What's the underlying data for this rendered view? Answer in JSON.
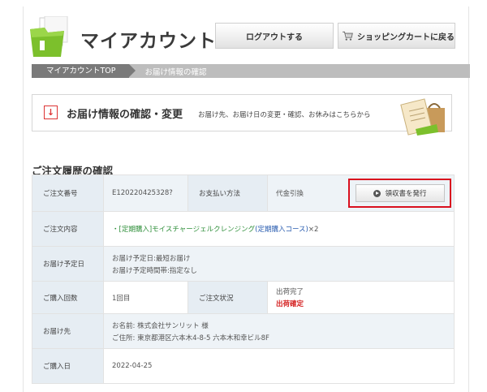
{
  "header": {
    "site_title": "マイアカウント",
    "logout_label": "ログアウトする",
    "cart_label": "ショッピングカートに戻る"
  },
  "breadcrumb": {
    "top": "マイアカウントTOP",
    "current": "お届け情報の確認"
  },
  "banner": {
    "title": "お届け情報の確認・変更",
    "subtitle": "お届け先、お届け日の変更・確認、お休みはこちらから"
  },
  "order": {
    "section_title": "ご注文履歴の確認",
    "receipt_button": "領収書を発行",
    "rows": {
      "order_number_label": "ご注文番号",
      "order_number": "E120220425328?",
      "payment_label": "お支払い方法",
      "payment_value": "代金引換",
      "content_label": "ご注文内容",
      "content_prefix": "・",
      "content_green": "[定期購入]モイスチャージェルクレンジング",
      "content_blue": "(定期購入コース)",
      "content_qty": "×2",
      "schedule_label": "お届け予定日",
      "schedule_line1": "お届け予定日:最短お届け",
      "schedule_line2": "お届け予定時間帯:指定なし",
      "count_label": "ご購入回数",
      "count_value": "1回目",
      "status_label": "ご注文状況",
      "status_line1": "出荷完了",
      "status_line2": "出荷確定",
      "dest_label": "お届け先",
      "dest_line1": "お名前: 株式会社サンリット 様",
      "dest_line2": "ご住所: 東京都港区六本木4-8-5 六本木和幸ビル8F",
      "date_label": "ご購入日",
      "date_value": "2022-04-25"
    }
  },
  "colors": {
    "highlight_border": "#d9101e",
    "logo_green": "#7cc02c",
    "label_cell": "#e6edf3"
  }
}
